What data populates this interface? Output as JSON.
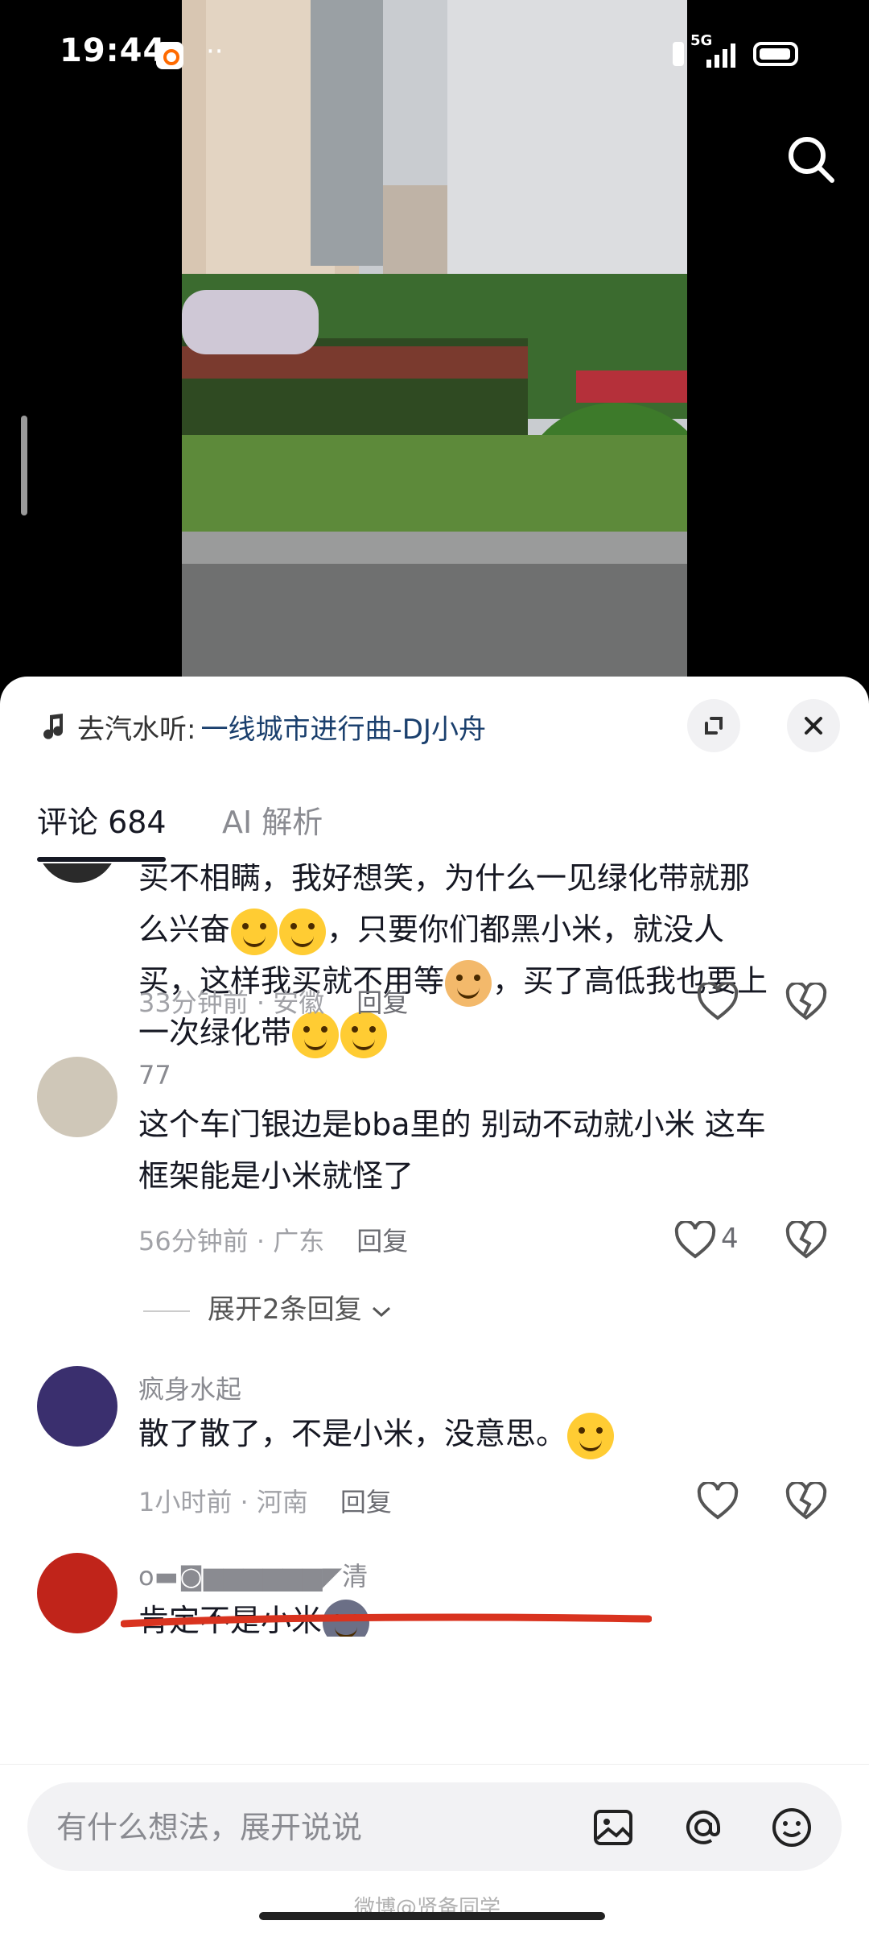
{
  "status_bar": {
    "time": "19:44",
    "dots": "··",
    "network": "5G"
  },
  "player": {
    "music_prefix": "去汽水听:",
    "music_title": "一线城市进行曲-DJ小舟"
  },
  "tabs": [
    {
      "label": "评论 684",
      "active": true
    },
    {
      "label": "AI 解析",
      "active": false
    }
  ],
  "comments": [
    {
      "user": "",
      "text_lines": [
        "买不相瞒，我好想笑，为什么一见绿化带就那",
        "么兴奋",
        "，只要你们都黑小米，就没人",
        "买，这样我买就不用等",
        "，买了高低我也要上",
        "一次绿化带"
      ],
      "time": "33分钟前",
      "location": "安徽",
      "reply_label": "回复",
      "likes": ""
    },
    {
      "user": "77",
      "text_lines": [
        "这个车门银边是bba里的 别动不动就小米 这车",
        "框架能是小米就怪了"
      ],
      "time": "56分钟前",
      "location": "广东",
      "reply_label": "回复",
      "likes": "4",
      "expand_label": "展开2条回复"
    },
    {
      "user": "疯身水起",
      "text_lines": [
        "散了散了，不是小米，没意思。"
      ],
      "time": "1小时前",
      "location": "河南",
      "reply_label": "回复",
      "likes": ""
    },
    {
      "user": "o▬◙▆▆▆▆▆▆◤清",
      "text_lines": [
        "肯定不是小米"
      ],
      "time": "",
      "location": "",
      "reply_label": "",
      "likes": ""
    }
  ],
  "separator": "·",
  "input": {
    "placeholder": "有什么想法，展开说说"
  },
  "watermark": "微博@贤备同学",
  "icons": [
    "search-icon",
    "music-note-icon",
    "collapse-icon",
    "close-icon",
    "heart-icon",
    "dislike-icon",
    "chevron-down-icon",
    "image-icon",
    "at-icon",
    "emoji-icon"
  ],
  "colors": {
    "accent_link": "#1a3f6d",
    "annotation_red": "#d9331f",
    "sheet_bg": "#ffffff"
  }
}
